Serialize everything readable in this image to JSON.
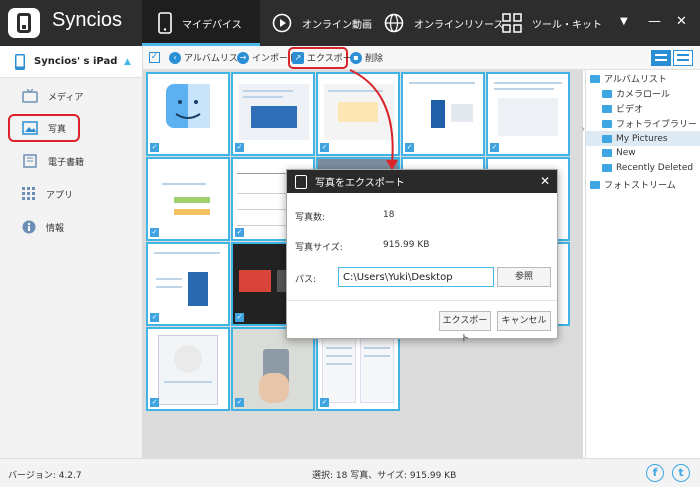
{
  "app": {
    "name": "Syncios"
  },
  "nav": {
    "devices": "マイデバイス",
    "online_video": "オンライン動画",
    "online_resources": "オンラインリソース",
    "tools": "ツール・キット"
  },
  "window_controls": {
    "menu": "▼",
    "minimize": "—",
    "close": "✕"
  },
  "sidebar": {
    "device_name": "Syncios' s iPad",
    "eject": "▲",
    "items": [
      {
        "label": "メディア",
        "icon": "tv-icon"
      },
      {
        "label": "写真",
        "icon": "photo-icon"
      },
      {
        "label": "電子書籍",
        "icon": "book-icon"
      },
      {
        "label": "アプリ",
        "icon": "apps-icon"
      },
      {
        "label": "情報",
        "icon": "info-icon"
      }
    ]
  },
  "toolbar": {
    "album_list": "アルバムリスト",
    "import": "インポート",
    "export": "エクスポート",
    "delete": "削除"
  },
  "right_panel": {
    "album_list": "アルバムリスト",
    "camera_roll": "カメラロール",
    "video": "ビデオ",
    "photo_library": "フォトライブラリー",
    "my_pictures": "My Pictures",
    "new": "New",
    "recently_deleted": "Recently Deleted",
    "photo_stream": "フォトストリーム"
  },
  "modal": {
    "title": "写真をエクスポート",
    "count_label": "写真数:",
    "count_value": "18",
    "size_label": "写真サイズ:",
    "size_value": "915.99 KB",
    "path_label": "パス:",
    "path_value": "C:\\Users\\Yuki\\Desktop",
    "browse": "参照",
    "export": "エクスポート",
    "cancel": "キャンセル"
  },
  "status": {
    "version": "バージョン: 4.2.7",
    "selection": "選択: 18 写真、サイズ: 915.99 KB",
    "facebook": "f",
    "twitter": "t"
  },
  "colors": {
    "accent": "#3fb4e5",
    "highlight": "#d9242c",
    "topbar": "#2d2d2d"
  }
}
